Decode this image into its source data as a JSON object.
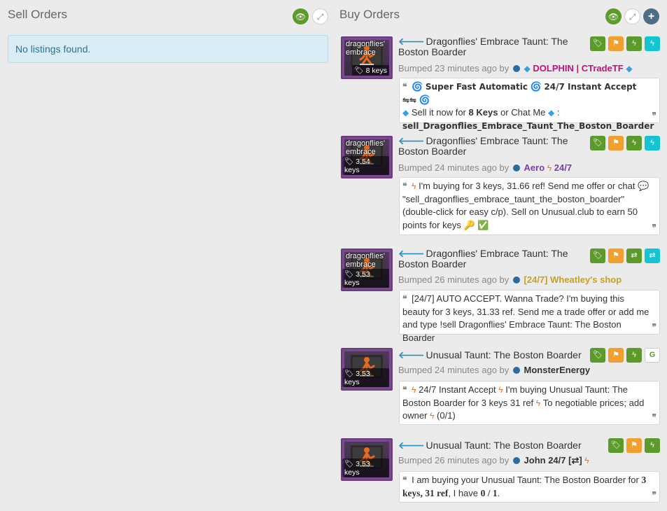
{
  "sell": {
    "title": "Sell Orders",
    "empty_text": "No listings found."
  },
  "buy": {
    "title": "Buy Orders"
  },
  "icons": {
    "eye": "eye-icon",
    "expand": "expand-icon",
    "plus": "plus-icon"
  },
  "colors": {
    "green": "#5c9b2b",
    "orange": "#f0a030",
    "cyan": "#15c4d3",
    "dolphin": "#c2127e",
    "aero": "#7a3cb0",
    "wheatley": "#c8a020"
  },
  "listings": [
    {
      "title": "Dragonflies' Embrace Taunt: The Boston Boarder",
      "image_label": "dragonflies' embrace",
      "price": "8 keys",
      "bumped_prefix": "Bumped 23 minutes ago by",
      "user": "DOLPHIN | CTradeTF",
      "badges": [
        "tag-icon",
        "flag-icon",
        "bolt-icon",
        "bolt-icon"
      ],
      "quote": {
        "part1": "Super Fast Automatic",
        "part2": "24/7 Instant Accept ⇋⇋",
        "part3": "Sell it now for",
        "part4": "8 Keys",
        "part5": "or Chat Me",
        "part6": ":",
        "part7": "sell_Dragonflies_Embrace_Taunt_The_Boston_Boarder"
      }
    },
    {
      "title": "Dragonflies' Embrace Taunt: The Boston Boarder",
      "image_label": "dragonflies' embrace",
      "price": "3.54 keys",
      "bumped_prefix": "Bumped 24 minutes ago by",
      "user": "Aero",
      "user_suffix": "24/7",
      "badges": [
        "tag-icon",
        "flag-icon",
        "bolt-icon",
        "bolt-icon"
      ],
      "quote": {
        "text1": "I'm buying for 3 keys, 31.66 ref! Send me offer or chat",
        "text2": "\"sell_dragonflies_embrace_taunt_the_boston_boarder\" (double-click for easy c/p). Sell on Unusual.club to earn 50 points for keys"
      }
    },
    {
      "title": "Dragonflies' Embrace Taunt: The Boston Boarder",
      "image_label": "dragonflies' embrace",
      "price": "3.53 keys",
      "bumped_prefix": "Bumped 26 minutes ago by",
      "user": "[24/7] Wheatley's shop",
      "badges": [
        "tag-icon",
        "flag-icon",
        "swap-icon",
        "swap-icon"
      ],
      "quote": {
        "text": "[24/7] AUTO ACCEPT. Wanna Trade? I'm buying this beauty for 3 keys, 31.33 ref. Send me a trade offer or add me and type !sell Dragonflies' Embrace Taunt: The Boston Boarder"
      }
    },
    {
      "title": "Unusual Taunt: The Boston Boarder",
      "price": "3.53 keys",
      "bumped_prefix": "Bumped 24 minutes ago by",
      "user": "MonsterEnergy",
      "badges": [
        "tag-icon",
        "flag-icon",
        "bolt-icon",
        "g-icon"
      ],
      "quote": {
        "text1": "24/7 Instant Accept",
        "text2": "I'm buying Unusual Taunt: The Boston Boarder for 3 keys 31 ref",
        "text3": "To negotiable prices; add owner",
        "text4": "(0/1)"
      }
    },
    {
      "title": "Unusual Taunt: The Boston Boarder",
      "price": "3.53 keys",
      "bumped_prefix": "Bumped 26 minutes ago by",
      "user": "John 24/7 [⇄]",
      "badges": [
        "tag-icon",
        "flag-icon",
        "bolt-icon"
      ],
      "quote": {
        "text1": "I am buying your Unusual Taunt: The Boston Boarder for",
        "b1": "3 keys, 31 ref",
        "text2": ", I have",
        "b2": "0 / 1",
        "text3": "."
      }
    }
  ]
}
